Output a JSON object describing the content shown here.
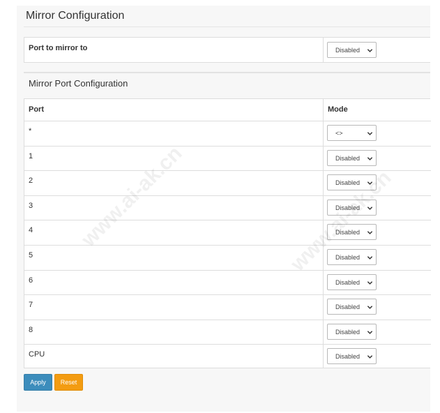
{
  "page_title": "Mirror Configuration",
  "mirror_to": {
    "label": "Port to mirror to",
    "value": "Disabled"
  },
  "section_title": "Mirror Port Configuration",
  "table": {
    "headers": {
      "port": "Port",
      "mode": "Mode"
    },
    "rows": [
      {
        "port": "*",
        "mode": "<>"
      },
      {
        "port": "1",
        "mode": "Disabled"
      },
      {
        "port": "2",
        "mode": "Disabled"
      },
      {
        "port": "3",
        "mode": "Disabled"
      },
      {
        "port": "4",
        "mode": "Disabled"
      },
      {
        "port": "5",
        "mode": "Disabled"
      },
      {
        "port": "6",
        "mode": "Disabled"
      },
      {
        "port": "7",
        "mode": "Disabled"
      },
      {
        "port": "8",
        "mode": "Disabled"
      },
      {
        "port": "CPU",
        "mode": "Disabled"
      }
    ]
  },
  "buttons": {
    "apply": "Apply",
    "reset": "Reset"
  },
  "watermark": "www.ai-ak.cn",
  "colors": {
    "apply": "#3c8dbc",
    "reset": "#f39c12"
  },
  "icons": {
    "select_arrow": "chevron-down-icon"
  }
}
